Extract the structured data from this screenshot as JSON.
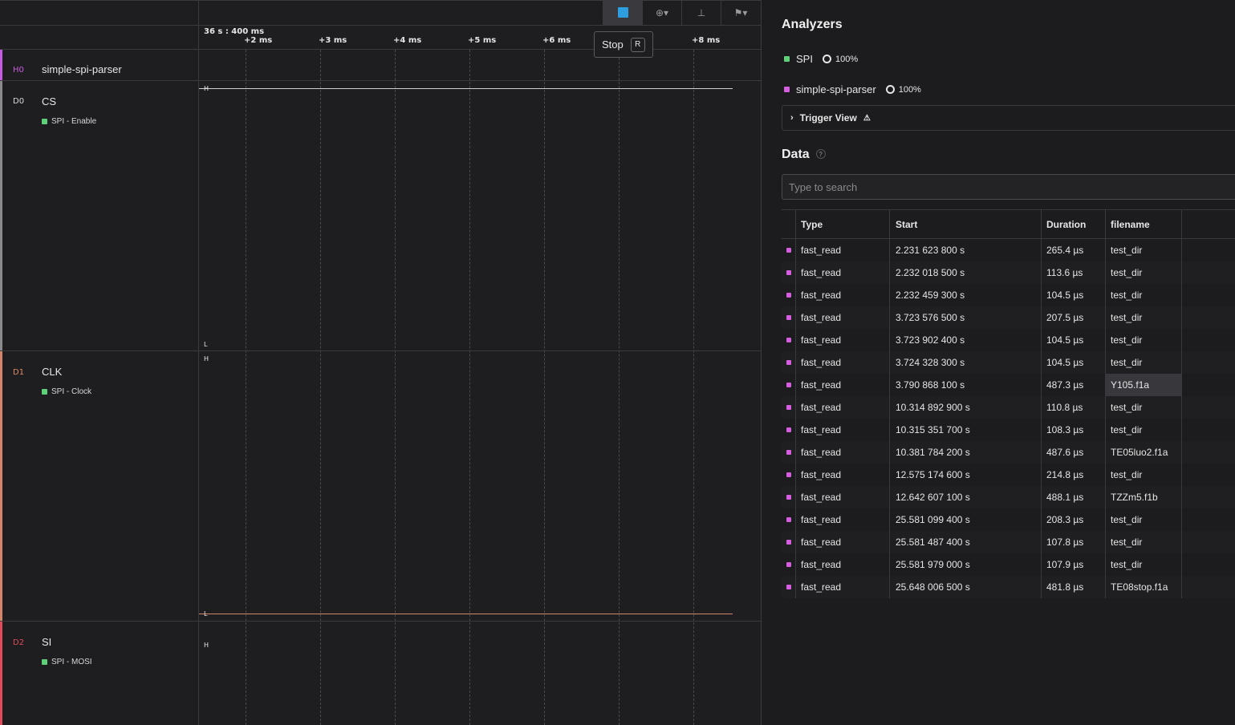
{
  "timeline": {
    "offset_label": "36 s : 400 ms",
    "ticks": [
      "+2 ms",
      "+3 ms",
      "+4 ms",
      "+5 ms",
      "+6 ms",
      "+8 ms"
    ]
  },
  "toolbar": {
    "tooltip_label": "Stop",
    "tooltip_key": "R",
    "stop_color": "#2d9ee0"
  },
  "channels": [
    {
      "id": "H0",
      "name": "simple-spi-parser",
      "color": "#c55be0"
    },
    {
      "id": "D0",
      "name": "CS",
      "tag": "SPI - Enable",
      "high": "H",
      "low": "L",
      "color": "#8a8a8a"
    },
    {
      "id": "D1",
      "name": "CLK",
      "tag": "SPI - Clock",
      "high": "H",
      "low": "L",
      "color": "#d4866a"
    },
    {
      "id": "D2",
      "name": "SI",
      "tag": "SPI - MOSI",
      "high": "H",
      "color": "#e04a5a"
    }
  ],
  "analyzers": {
    "title": "Analyzers",
    "items": [
      {
        "name": "SPI",
        "progress": "100%",
        "color": "#5fd07a"
      },
      {
        "name": "simple-spi-parser",
        "progress": "100%",
        "color": "#d45ee0"
      }
    ],
    "trigger_label": "Trigger View"
  },
  "data": {
    "title": "Data",
    "search_placeholder": "Type to search",
    "columns": [
      "Type",
      "Start",
      "Duration",
      "filename"
    ],
    "rows": [
      [
        "fast_read",
        "2.231 623 800 s",
        "265.4 µs",
        "test_dir"
      ],
      [
        "fast_read",
        "2.232 018 500 s",
        "113.6 µs",
        "test_dir"
      ],
      [
        "fast_read",
        "2.232 459 300 s",
        "104.5 µs",
        "test_dir"
      ],
      [
        "fast_read",
        "3.723 576 500 s",
        "207.5 µs",
        "test_dir"
      ],
      [
        "fast_read",
        "3.723 902 400 s",
        "104.5 µs",
        "test_dir"
      ],
      [
        "fast_read",
        "3.724 328 300 s",
        "104.5 µs",
        "test_dir"
      ],
      [
        "fast_read",
        "3.790 868 100 s",
        "487.3 µs",
        "Y105.f1a"
      ],
      [
        "fast_read",
        "10.314 892 900 s",
        "110.8 µs",
        "test_dir"
      ],
      [
        "fast_read",
        "10.315 351 700 s",
        "108.3 µs",
        "test_dir"
      ],
      [
        "fast_read",
        "10.381 784 200 s",
        "487.6 µs",
        "TE05luo2.f1a"
      ],
      [
        "fast_read",
        "12.575 174 600 s",
        "214.8 µs",
        "test_dir"
      ],
      [
        "fast_read",
        "12.642 607 100 s",
        "488.1 µs",
        "TZZm5.f1b"
      ],
      [
        "fast_read",
        "25.581 099 400 s",
        "208.3 µs",
        "test_dir"
      ],
      [
        "fast_read",
        "25.581 487 400 s",
        "107.8 µs",
        "test_dir"
      ],
      [
        "fast_read",
        "25.581 979 000 s",
        "107.9 µs",
        "test_dir"
      ],
      [
        "fast_read",
        "25.648 006 500 s",
        "481.8 µs",
        "TE08stop.f1a"
      ]
    ]
  }
}
